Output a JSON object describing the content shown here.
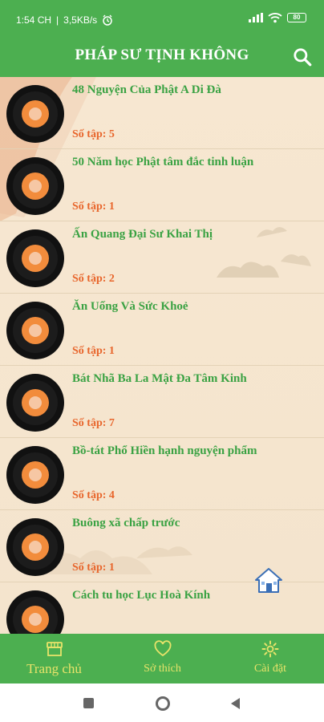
{
  "status": {
    "time": "1:54 CH",
    "speed": "3,5KB/s",
    "battery": "80"
  },
  "app": {
    "title": "PHÁP SƯ TỊNH KHÔNG"
  },
  "items": [
    {
      "title": "48 Nguyện Của Phật A Di Đà",
      "count": "Số tập: 5"
    },
    {
      "title": "50 Năm học Phật tâm đắc tinh luận",
      "count": "Số tập: 1"
    },
    {
      "title": "Ấn Quang Đại Sư Khai Thị",
      "count": "Số tập: 2"
    },
    {
      "title": "Ăn Uống Và Sức Khoẻ",
      "count": "Số tập: 1"
    },
    {
      "title": "Bát Nhã Ba La Mật Đa Tâm Kinh",
      "count": "Số tập: 7"
    },
    {
      "title": "Bồ-tát Phổ Hiền hạnh nguyện phẩm",
      "count": "Số tập: 4"
    },
    {
      "title": "Buông xã chấp trước",
      "count": "Số tập: 1"
    },
    {
      "title": "Cách tu học Lục Hoà Kính",
      "count": ""
    }
  ],
  "nav": {
    "home": "Trang chủ",
    "fav": "Sở thích",
    "settings": "Cài đặt"
  },
  "colors": {
    "primary": "#4caf50",
    "title_text": "#3aa243",
    "count_text": "#e8652b",
    "nav_text": "#e8e36a"
  }
}
